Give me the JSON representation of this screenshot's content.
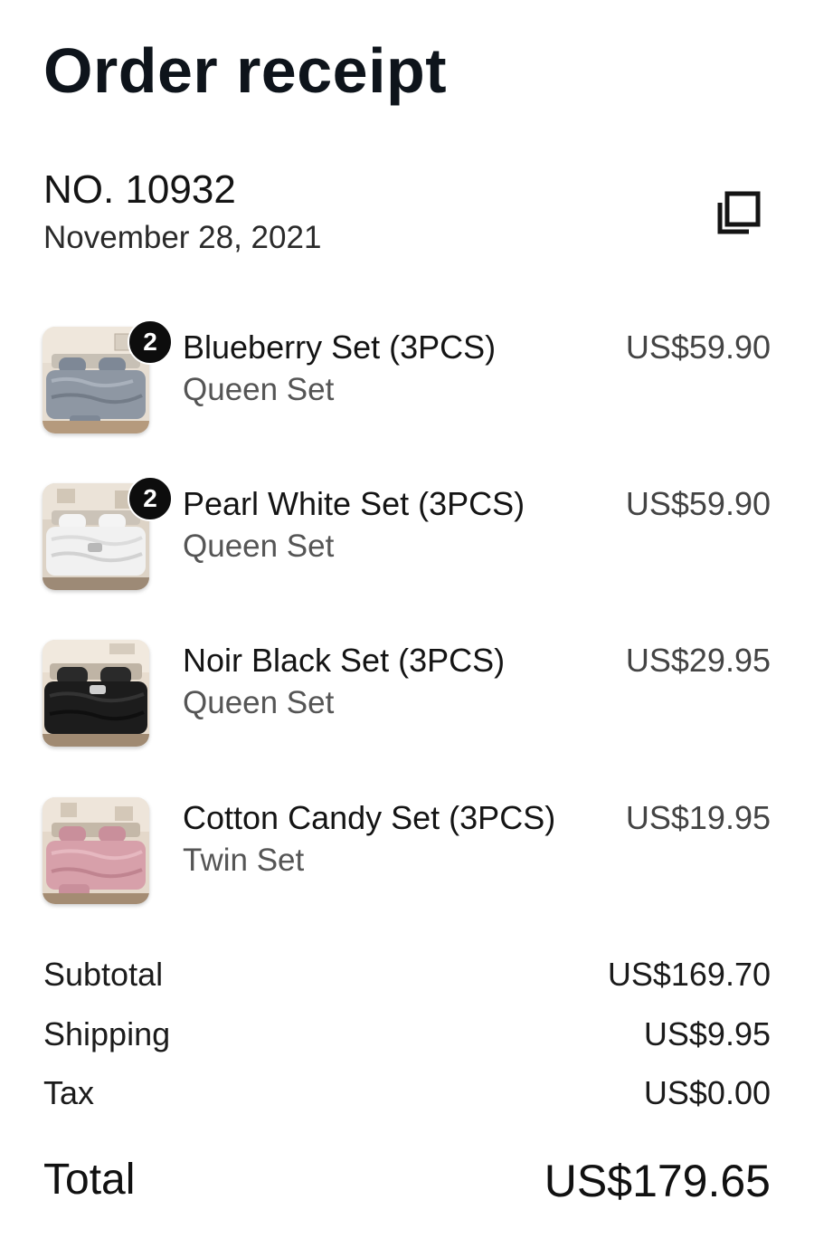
{
  "header": {
    "title": "Order receipt"
  },
  "order": {
    "number": "NO. 10932",
    "date": "November 28, 2021",
    "copy_icon": "copy-icon"
  },
  "items": [
    {
      "name": "Blueberry Set (3PCS)",
      "variant": "Queen Set",
      "price": "US$59.90",
      "quantity": "2",
      "image_icon": "bedding-photo-blue-gray",
      "color": "#8e97a3"
    },
    {
      "name": "Pearl White Set (3PCS)",
      "variant": "Queen Set",
      "price": "US$59.90",
      "quantity": "2",
      "image_icon": "bedding-photo-white",
      "color": "#ececec"
    },
    {
      "name": "Noir Black Set (3PCS)",
      "variant": "Queen Set",
      "price": "US$29.95",
      "quantity": "",
      "image_icon": "bedding-photo-black",
      "color": "#1c1c1c"
    },
    {
      "name": "Cotton Candy Set (3PCS)",
      "variant": "Twin Set",
      "price": "US$19.95",
      "quantity": "",
      "image_icon": "bedding-photo-pink",
      "color": "#d7a0aa"
    }
  ],
  "summary": {
    "subtotal_label": "Subtotal",
    "subtotal_value": "US$169.70",
    "shipping_label": "Shipping",
    "shipping_value": "US$9.95",
    "tax_label": "Tax",
    "tax_value": "US$0.00",
    "total_label": "Total",
    "total_value": "US$179.65"
  }
}
